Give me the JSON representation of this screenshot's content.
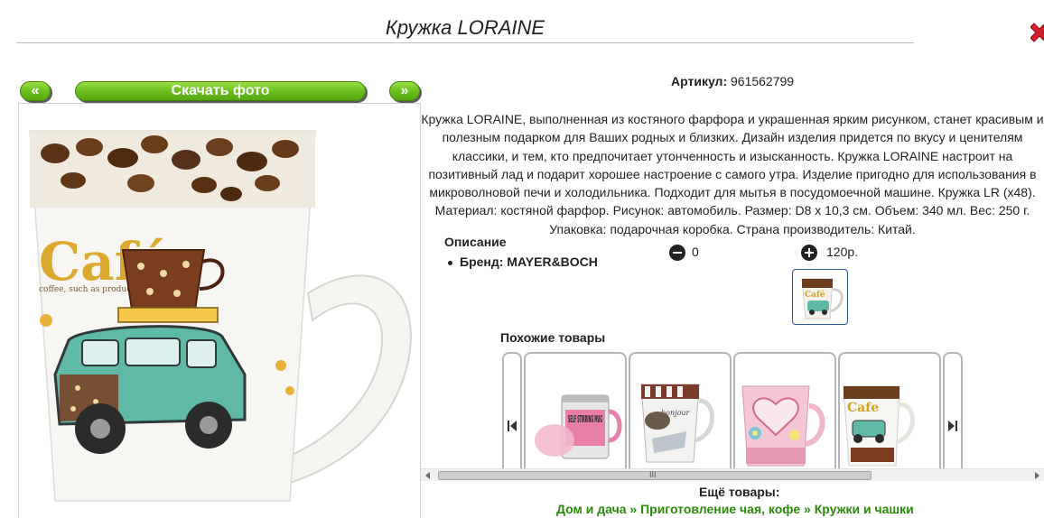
{
  "page": {
    "title": "Кружка LORAINE"
  },
  "gallery": {
    "prev_label": "«",
    "download_label": "Скачать фото",
    "next_label": "»"
  },
  "product": {
    "sku_label": "Артикул:",
    "sku_value": "961562799",
    "description": "Кружка LORAINE, выполненная из костяного фарфора и украшенная ярким рисунком, станет красивым и полезным подарком для Ваших родных и близких. Дизайн изделия придется по вкусу и ценителям классики, и тем, кто предпочитает утонченность и изысканность. Кружка LORAINE настроит на позитивный лад и подарит хорошее настроение с самого утра. Изделие пригодно для использования в микроволновой печи и холодильника. Подходит для мытья в посудомоечной машине. Кружка LR (x48). Материал: костяной фарфор. Рисунок: автомобиль. Размер: D8 х 10,3 см. Объем: 340 мл. Вес: 250 г. Упаковка: подарочная коробка. Страна производитель: Китай.",
    "desc_heading": "Описание",
    "brand_text": "Бренд: MAYER&BOCH",
    "quantity": "0",
    "price": "120р."
  },
  "similar": {
    "heading": "Похожие товары",
    "cards": [
      {
        "label": "SELF STIRRING MUG"
      },
      {
        "label": "bonjour"
      },
      {
        "label": ""
      },
      {
        "label": "Cafe"
      }
    ]
  },
  "more": {
    "heading": "Ещё товары:",
    "crumbs": [
      "Дом и дача",
      "Приготовление чая, кофе",
      "Кружки и чашки"
    ],
    "separator": "»"
  },
  "colors": {
    "button_green": "#6cbf1e",
    "link_green": "#2a8a0a",
    "close_red": "#d0202a",
    "thumb_border": "#2c5aa0"
  }
}
